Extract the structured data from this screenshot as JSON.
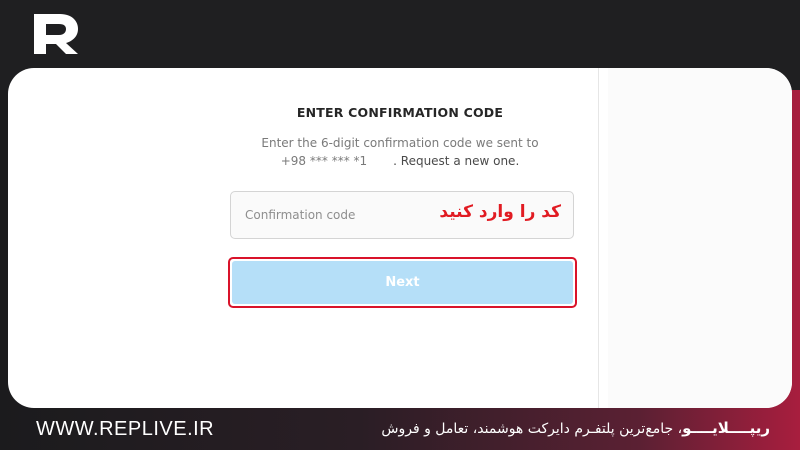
{
  "brand": {
    "logo_icon": "replive-logo-icon",
    "website": "WWW.REPLIVE.IR",
    "tagline_brand": "ریپــــلایــــو",
    "tagline_rest": "، جامع‌ترین پلتفـرم دایرکت هوشمند، تعامل و فروش"
  },
  "form": {
    "title": "ENTER CONFIRMATION CODE",
    "description_line1": "Enter the 6-digit confirmation code we sent to",
    "phone_masked": "+98 *** *** *1",
    "request_text": ". Request a new one.",
    "code_input": {
      "placeholder": "Confirmation code",
      "value": ""
    },
    "annotation": "کد را وارد کنید",
    "next_label": "Next"
  },
  "colors": {
    "accent_red": "#e11b22",
    "next_button_bg": "#b5dff8",
    "footer_gradient_end": "#a81e3e"
  }
}
